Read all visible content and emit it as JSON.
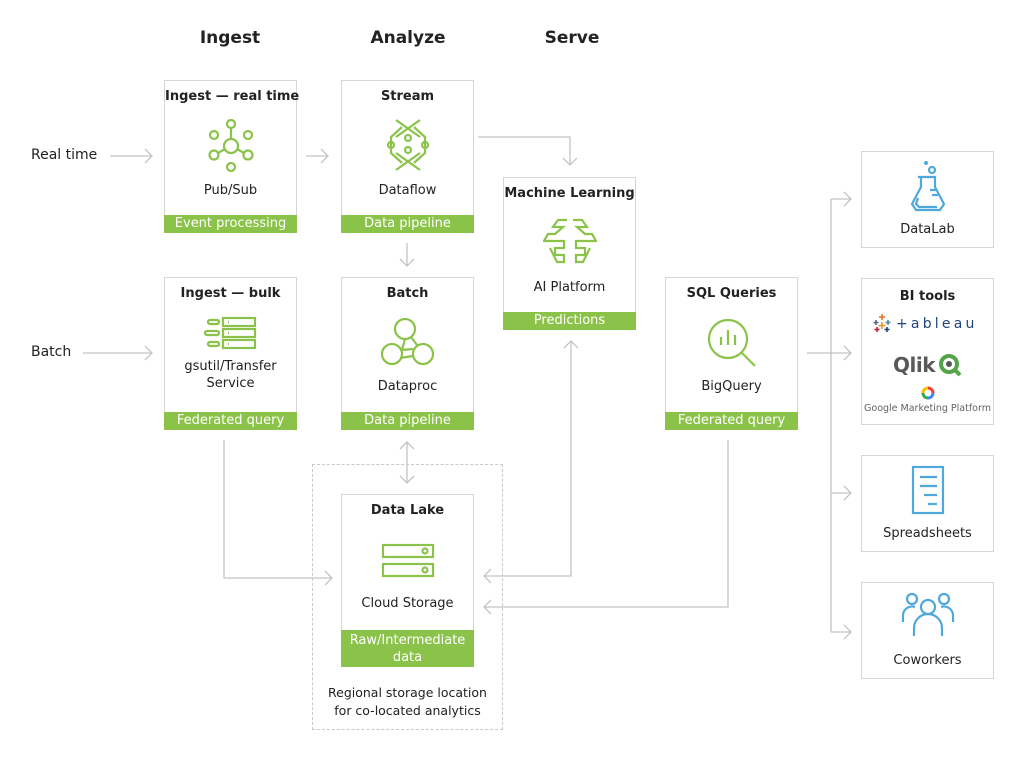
{
  "columns": {
    "ingest": "Ingest",
    "analyze": "Analyze",
    "serve": "Serve"
  },
  "inputs": {
    "real_time": "Real time",
    "batch": "Batch"
  },
  "boxes": {
    "ingest_realtime": {
      "title": "Ingest — real time",
      "name": "Pub/Sub",
      "tag": "Event processing",
      "icon": "pubsub-icon"
    },
    "stream": {
      "title": "Stream",
      "name": "Dataflow",
      "tag": "Data pipeline",
      "icon": "dataflow-icon"
    },
    "ingest_bulk": {
      "title": "Ingest — bulk",
      "name_line1": "gsutil/Transfer",
      "name_line2": "Service",
      "tag": "Federated query",
      "icon": "transfer-service-icon"
    },
    "batch": {
      "title": "Batch",
      "name": "Dataproc",
      "tag": "Data pipeline",
      "icon": "dataproc-icon"
    },
    "ml": {
      "title": "Machine Learning",
      "name": "AI Platform",
      "tag": "Predictions",
      "icon": "ai-platform-icon"
    },
    "sql": {
      "title": "SQL Queries",
      "name": "BigQuery",
      "tag": "Federated query",
      "icon": "bigquery-icon"
    },
    "data_lake": {
      "title": "Data Lake",
      "name": "Cloud Storage",
      "tag_line1": "Raw/Intermediate",
      "tag_line2": "data",
      "icon": "cloud-storage-icon"
    }
  },
  "region_note": {
    "line1": "Regional storage location",
    "line2": "for co-located analytics"
  },
  "outputs": {
    "datalab": {
      "name": "DataLab",
      "icon": "datalab-flask-icon"
    },
    "bi_tools": {
      "title": "BI tools",
      "brands": [
        "tableau",
        "Qlik",
        "Google Marketing Platform"
      ]
    },
    "spreadsheets": {
      "name": "Spreadsheets",
      "icon": "spreadsheet-icon"
    },
    "coworkers": {
      "name": "Coworkers",
      "icon": "coworkers-icon"
    }
  },
  "colors": {
    "accent_green": "#8bc34a",
    "icon_blue": "#4fa8dc",
    "wire_gray": "#c4c4c4"
  }
}
